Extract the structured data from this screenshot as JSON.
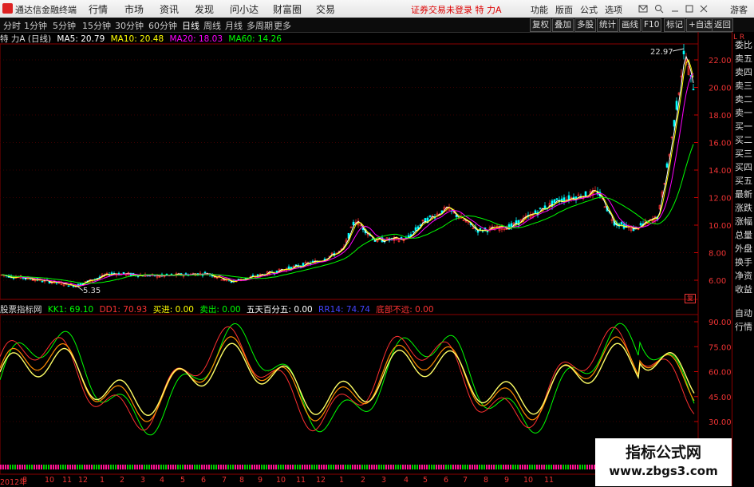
{
  "app": {
    "title": "通达信金融终端"
  },
  "menu": [
    "行情",
    "市场",
    "资讯",
    "发现",
    "问小达",
    "财富圈",
    "交易"
  ],
  "status": "证券交易未登录 特 力A",
  "menu_right": [
    "功能",
    "版面",
    "公式",
    "选项"
  ],
  "guest": "游客",
  "tabs": [
    "分时",
    "1分钟",
    "5分钟",
    "15分钟",
    "30分钟",
    "60分钟",
    "日线",
    "周线",
    "月线",
    "多周期",
    "更多"
  ],
  "tab_buttons": [
    "复权",
    "叠加",
    "多股",
    "统计",
    "画线",
    "F10",
    "标记",
    "+自选",
    "返回"
  ],
  "ma": {
    "title": "特 力A (日线)",
    "ma5": "MA5: 20.79",
    "ma10": "MA10: 20.48",
    "ma20": "MA20: 18.03",
    "ma60": "MA60: 14.26"
  },
  "indicator": {
    "name": "股票指标网",
    "kk1": "KK1: 69.10",
    "dd1": "DD1: 70.93",
    "buy": "买进: 0.00",
    "sell": "卖出: 0.00",
    "w5": "五天百分五: 0.00",
    "rr": "RR14: 74.74",
    "bottom": "底部不远: 0.00"
  },
  "price_high_label": "22.97",
  "price_low_label": "5.35",
  "price_ticks": [
    "22.00",
    "20.00",
    "18.00",
    "16.00",
    "14.00",
    "12.00",
    "10.00",
    "8.00",
    "6.00"
  ],
  "ind_ticks": [
    "90.00",
    "75.00",
    "60.00",
    "45.00",
    "30.00"
  ],
  "right_tabs": [
    "委比",
    "卖五",
    "卖四",
    "卖三",
    "卖二",
    "卖一",
    "买一",
    "买二",
    "买三",
    "买四",
    "买五",
    "最新",
    "涨跌",
    "涨幅",
    "总量",
    "外盘",
    "换手",
    "净资",
    "收益"
  ],
  "right_bottom": [
    "自动",
    "行情"
  ],
  "right_corner": "L R",
  "price_box": "复",
  "dates": [
    "2012年",
    "8",
    "10",
    "11",
    "12",
    "1",
    "2",
    "3",
    "4",
    "5",
    "6",
    "7",
    "8",
    "9",
    "10",
    "11",
    "12",
    "1",
    "2",
    "3",
    "4",
    "5",
    "6",
    "7",
    "8",
    "9",
    "10",
    "11"
  ],
  "watermark": {
    "line1": "指标公式网",
    "line2": "www.zbgs3.com"
  },
  "colors": {
    "up": "#ff3030",
    "down": "#00ffff",
    "ma5": "#ffffff",
    "ma10": "#ffff00",
    "ma20": "#ff00ff",
    "ma60": "#00ff00"
  }
}
